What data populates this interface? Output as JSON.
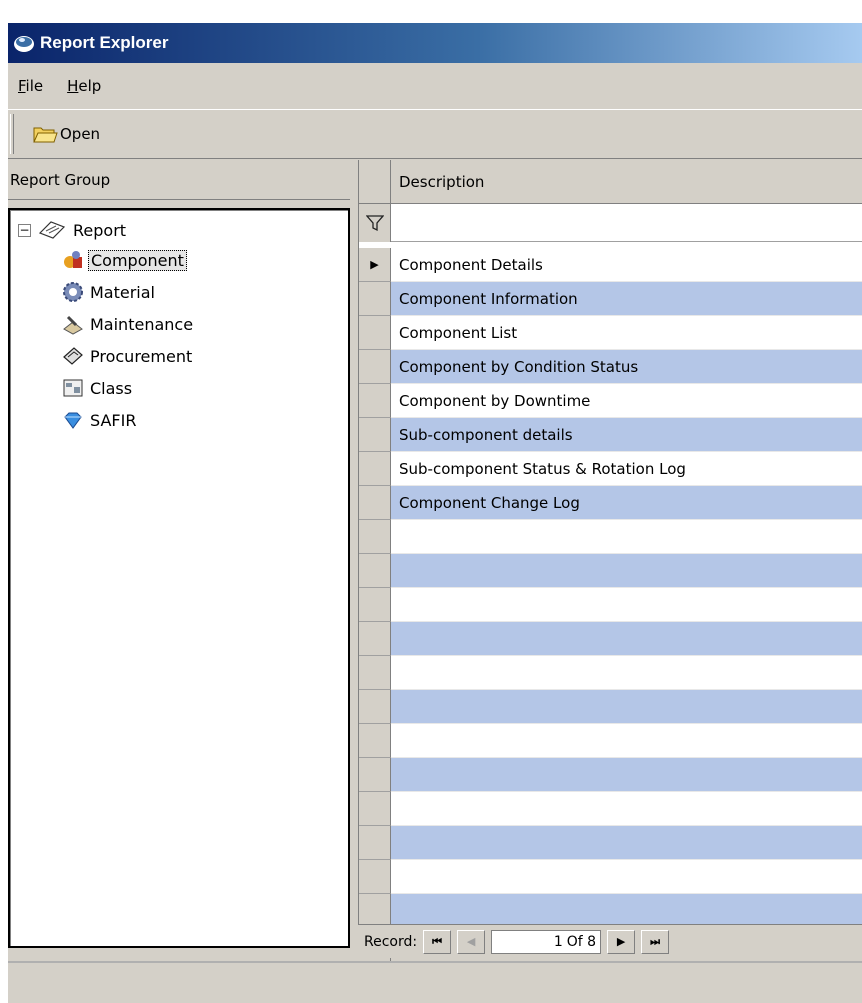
{
  "window": {
    "title": "Report Explorer"
  },
  "menu": [
    {
      "accel": "F",
      "rest": "ile"
    },
    {
      "accel": "H",
      "rest": "elp"
    }
  ],
  "toolbar": {
    "open_label": "Open"
  },
  "left_panel": {
    "header": "Report Group",
    "root": {
      "label": "Report",
      "expander": "−"
    },
    "items": [
      {
        "label": "Component",
        "icon": "component-icon",
        "selected": true
      },
      {
        "label": "Material",
        "icon": "gear-icon"
      },
      {
        "label": "Maintenance",
        "icon": "maintenance-icon"
      },
      {
        "label": "Procurement",
        "icon": "procurement-icon"
      },
      {
        "label": "Class",
        "icon": "class-icon"
      },
      {
        "label": "SAFIR",
        "icon": "diamond-icon"
      }
    ]
  },
  "grid": {
    "column": "Description",
    "rows": [
      "Component Details",
      "Component Information",
      "Component List",
      "Component by Condition Status",
      "Component by Downtime",
      "Sub-component details",
      "Sub-component Status & Rotation Log",
      "Component Change Log"
    ],
    "current_row_marker": "▶"
  },
  "navigator": {
    "label": "Record:",
    "current": "1",
    "of_text": "Of 8",
    "first": "⏮",
    "prev": "◀",
    "next": "▶",
    "last": "⏭"
  },
  "colors": {
    "alt_row": "#b4c6e7",
    "title_start": "#0a246a",
    "chrome": "#d4d0c8"
  }
}
